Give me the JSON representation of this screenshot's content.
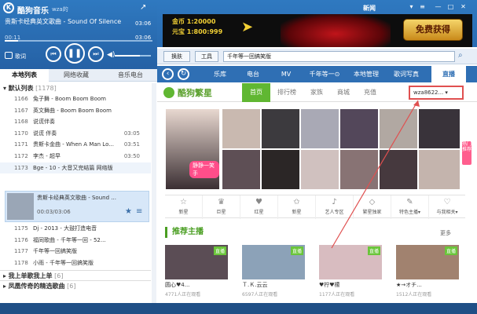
{
  "app": {
    "title": "酷狗音乐",
    "user": "wza的"
  },
  "player": {
    "song": "贵斯卡经典英文歌曲 - Sound Of Silence",
    "song_sub": "歌词",
    "time_elapsed": "00:11",
    "time_total": "03:06",
    "progress_fraction": 0.09,
    "volume_fraction": 0.7,
    "lyrics_label": "歌词"
  },
  "left_tabs": [
    {
      "label": "本地列表"
    },
    {
      "label": "网络收藏"
    },
    {
      "label": "音乐电台"
    }
  ],
  "playlist": {
    "group_default": "默认列表",
    "group_default_count": "[1178]",
    "rows": [
      {
        "num": "1166",
        "title": "兔子舞 - Boom Boom Boom",
        "dur": ""
      },
      {
        "num": "1167",
        "title": "英文舞曲 - Boom Boom Boom",
        "dur": ""
      },
      {
        "num": "1168",
        "title": "说谎伴奏",
        "dur": ""
      },
      {
        "num": "1170",
        "title": "说谎 伴奏",
        "dur": "03:05"
      },
      {
        "num": "1171",
        "title": "贵斯卡金曲 - When A Man Lo...",
        "dur": "03:51"
      },
      {
        "num": "1172",
        "title": "李杰 - 超早",
        "dur": "03:50"
      },
      {
        "num": "1173",
        "title": "Bge - 10 - 大音又完结篇 网络版",
        "dur": ""
      }
    ],
    "now_playing": {
      "title": "贵斯卡经典英文歌曲 - Sound ...",
      "time": "00:03/03:06"
    },
    "rows_after": [
      {
        "num": "1175",
        "title": "Dj - 2013 - 大鼓打造电音",
        "dur": ""
      },
      {
        "num": "1176",
        "title": "福同歌曲 - 千年等一回 - 52...",
        "dur": ""
      },
      {
        "num": "1177",
        "title": "千年等一回搞笑版",
        "dur": ""
      },
      {
        "num": "1178",
        "title": "小雨 - 千年等一回搞笑版",
        "dur": ""
      }
    ],
    "group_love": "我上单歌我上单",
    "group_love_count": "[6]",
    "group_net": "凤凰传奇的精选歌曲",
    "group_net_count": "[6]"
  },
  "top": {
    "username": "新闻",
    "banner_line1": "金币 1:20000",
    "banner_line2": "元宝 1:800:999",
    "banner_btn": "免费获得"
  },
  "toolrow": {
    "icon_btn_label": "换肤",
    "tools_label": "工具",
    "search_value": "千年等一回搞笑版"
  },
  "nav": [
    {
      "label": "乐库"
    },
    {
      "label": "电台"
    },
    {
      "label": "MV"
    },
    {
      "label": "千年等一⊙"
    },
    {
      "label": "本地管理"
    },
    {
      "label": "歌词写真"
    },
    {
      "label": "直播"
    }
  ],
  "kugou": {
    "logo": "酷狗繁星",
    "tabs": [
      {
        "label": "首页"
      },
      {
        "label": "排行榜"
      },
      {
        "label": "家族"
      },
      {
        "label": "商城"
      },
      {
        "label": "充值"
      }
    ],
    "user_dropdown": "wza8622..."
  },
  "hero_badge": "静静一笑手",
  "side_tag": "热门推荐",
  "categories": [
    {
      "label": "新星",
      "icon": "star-icon"
    },
    {
      "label": "巨星",
      "icon": "crown-icon"
    },
    {
      "label": "红星",
      "icon": "heart-icon"
    },
    {
      "label": "新星",
      "icon": "star-outline-icon"
    },
    {
      "label": "艺人专区",
      "icon": "microphone-icon"
    },
    {
      "label": "繁星独家",
      "icon": "diamond-icon"
    },
    {
      "label": "特色主播▾",
      "icon": "mic-icon"
    },
    {
      "label": "与我相关▾",
      "icon": "heart-outline-icon"
    }
  ],
  "recommend": {
    "title": "推荐主播",
    "more": "更多",
    "badge": "直播",
    "anchors": [
      {
        "name": "圆心♥4...",
        "viewers": "4771人正在观看"
      },
      {
        "name": "Ｔ.Ｋ.云云",
        "viewers": "6597人正在观看"
      },
      {
        "name": "♥柠♥檬",
        "viewers": "1177人正在观看"
      },
      {
        "name": "★→オチ...",
        "viewers": "1512人正在观看"
      }
    ]
  },
  "colors": {
    "accent": "#2f6fb4",
    "kugou_green": "#60b732",
    "highlight_red": "#e05050"
  }
}
